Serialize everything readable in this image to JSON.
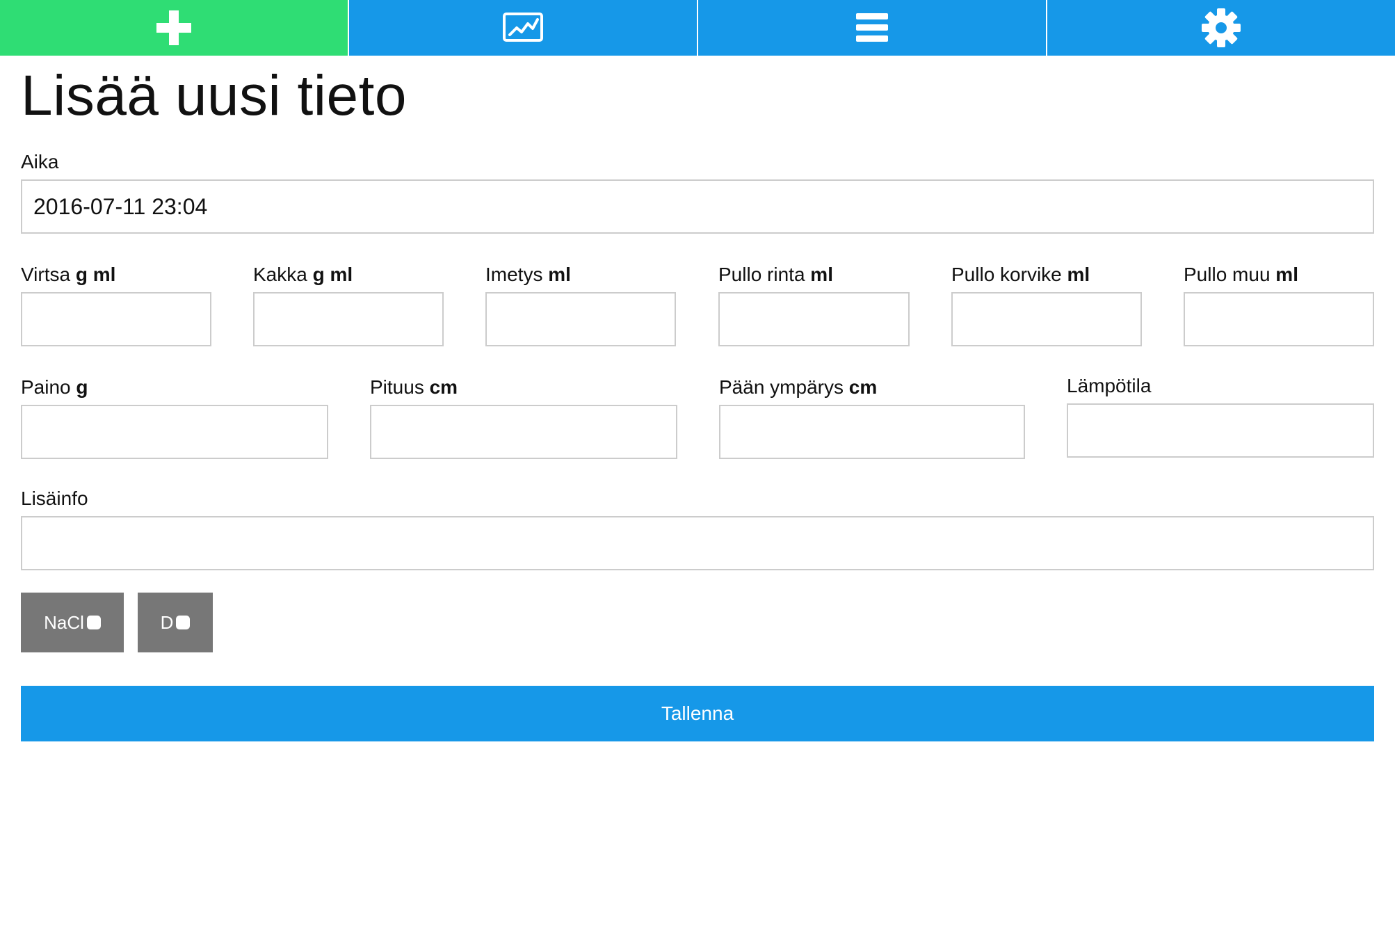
{
  "nav": {
    "tabs": [
      {
        "name": "add",
        "icon": "plus-icon",
        "active": true
      },
      {
        "name": "charts",
        "icon": "chart-icon",
        "active": false
      },
      {
        "name": "list",
        "icon": "list-icon",
        "active": false
      },
      {
        "name": "settings",
        "icon": "gear-icon",
        "active": false
      }
    ],
    "colors": {
      "active": "#2fdd74",
      "inactive": "#1698e8"
    }
  },
  "page": {
    "title": "Lisää uusi tieto"
  },
  "form": {
    "time": {
      "label": "Aika",
      "value": "2016-07-11 23:04"
    },
    "urine": {
      "label": "Virtsa",
      "unit": "g ml",
      "value": ""
    },
    "poop": {
      "label": "Kakka",
      "unit": "g ml",
      "value": ""
    },
    "breastfeeding": {
      "label": "Imetys",
      "unit": "ml",
      "value": ""
    },
    "bottle_breast": {
      "label": "Pullo rinta",
      "unit": "ml",
      "value": ""
    },
    "bottle_formula": {
      "label": "Pullo korvike",
      "unit": "ml",
      "value": ""
    },
    "bottle_other": {
      "label": "Pullo muu",
      "unit": "ml",
      "value": ""
    },
    "weight": {
      "label": "Paino",
      "unit": "g",
      "value": ""
    },
    "length": {
      "label": "Pituus",
      "unit": "cm",
      "value": ""
    },
    "head": {
      "label": "Pään ympärys",
      "unit": "cm",
      "value": ""
    },
    "temperature": {
      "label": "Lämpötila",
      "value": ""
    },
    "info": {
      "label": "Lisäinfo",
      "value": ""
    },
    "checks": [
      {
        "label": "NaCl",
        "checked": false
      },
      {
        "label": "D",
        "checked": false
      }
    ],
    "save_label": "Tallenna"
  },
  "colors": {
    "accent": "#1698e8",
    "active_tab": "#2fdd74",
    "check_button": "#777777",
    "field_border": "#cccccc"
  }
}
